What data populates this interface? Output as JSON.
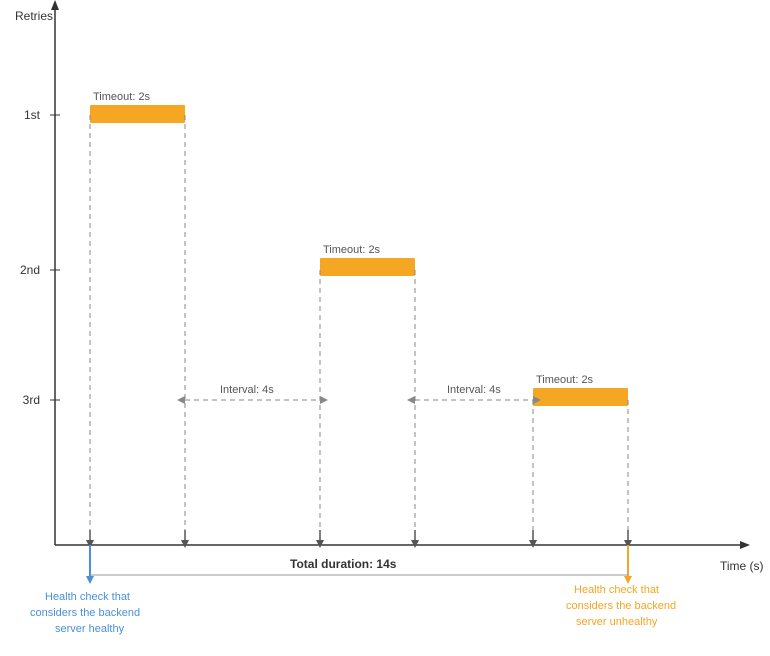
{
  "chart": {
    "title": "",
    "xAxisLabel": "Time (s)",
    "yAxisLabel": "Retries",
    "totalDuration": "Total duration: 14s",
    "timeoutLabel": "Timeout: 2s",
    "intervalLabel1": "Interval: 4s",
    "intervalLabel2": "Interval: 4s",
    "retryLabels": [
      "1st",
      "2nd",
      "3rd"
    ],
    "healthyAnnotation": [
      "Health check that",
      "considers the backend",
      "server healthy"
    ],
    "unhealthyAnnotation": [
      "Health check that",
      "considers the backend",
      "server unhealthy"
    ],
    "colors": {
      "orange": "#F5A623",
      "blue": "#4A90D9",
      "axis": "#333",
      "dashed": "#888",
      "arrow": "#555"
    }
  }
}
